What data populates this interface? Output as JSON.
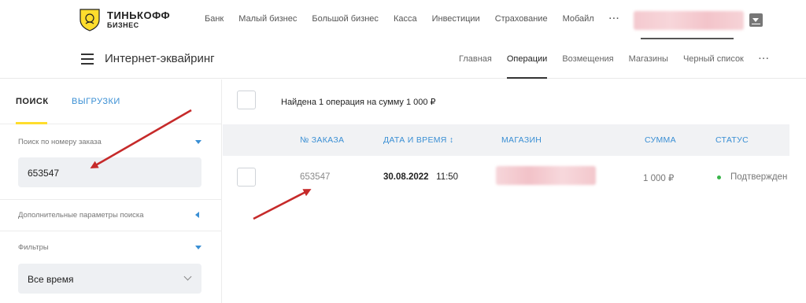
{
  "brand": {
    "name": "ТИНЬКОФФ",
    "sub": "БИЗНЕС"
  },
  "topnav": [
    "Банк",
    "Малый бизнес",
    "Большой бизнес",
    "Касса",
    "Инвестиции",
    "Страхование",
    "Мобайл",
    "···"
  ],
  "subbar": {
    "title": "Интернет-эквайринг",
    "nav": [
      "Главная",
      "Операции",
      "Возмещения",
      "Магазины",
      "Черный список",
      "···"
    ],
    "active_index": 1
  },
  "left": {
    "tabs": [
      "ПОИСК",
      "ВЫГРУЗКИ"
    ],
    "order_search_label": "Поиск по номеру заказа",
    "order_search_value": "653547",
    "extra_params_label": "Дополнительные параметры поиска",
    "filters_label": "Фильтры",
    "period_value": "Все время"
  },
  "results": {
    "found_text": "Найдена 1 операция на сумму 1 000 ₽",
    "columns": [
      "№ ЗАКАЗА",
      "ДАТА И ВРЕМЯ ↕",
      "МАГАЗИН",
      "СУММА",
      "СТАТУС"
    ],
    "rows": [
      {
        "order": "653547",
        "date": "30.08.2022",
        "time": "11:50",
        "shop": "",
        "sum": "1 000 ₽",
        "status": "Подтвержден"
      }
    ]
  },
  "colors": {
    "accent_yellow": "#ffdd2d",
    "link_blue": "#3a8fd4",
    "arrow_red": "#c62a2a",
    "status_green": "#39b54a"
  }
}
